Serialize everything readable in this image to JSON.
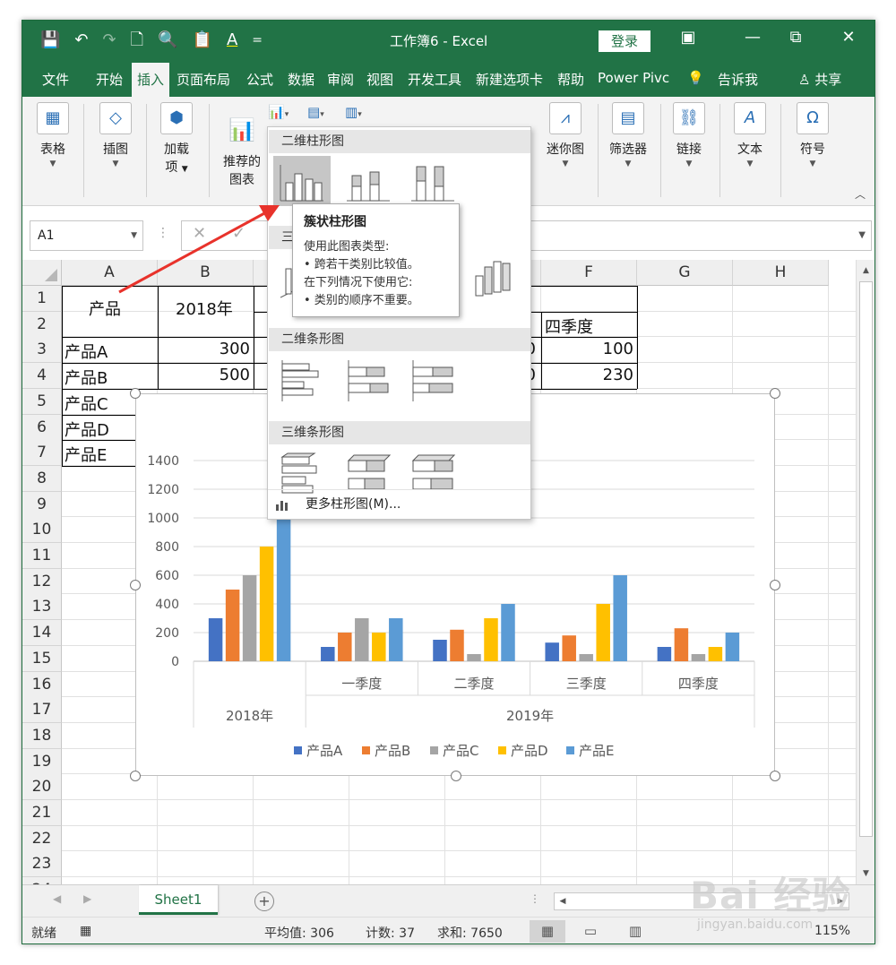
{
  "window": {
    "title": "工作簿6  -  Excel",
    "login_label": "登录",
    "minimize": "—",
    "restore": "⧉",
    "close": "✕",
    "ribbon_display": "▣"
  },
  "qat": {
    "save_icon": "💾",
    "undo_icon": "↶",
    "redo_icon": "↷",
    "new_icon": "🗋",
    "preview_icon": "🔍",
    "paste_icon": "📋",
    "font_color_label": "A",
    "more_icon": "="
  },
  "tabs": [
    {
      "label": "文件"
    },
    {
      "label": "开始"
    },
    {
      "label": "插入",
      "active": true
    },
    {
      "label": "页面布局"
    },
    {
      "label": "公式"
    },
    {
      "label": "数据"
    },
    {
      "label": "审阅"
    },
    {
      "label": "视图"
    },
    {
      "label": "开发工具"
    },
    {
      "label": "新建选项卡"
    },
    {
      "label": "帮助"
    },
    {
      "label": "Power Pivc"
    },
    {
      "label": "告诉我"
    },
    {
      "label": "共享"
    }
  ],
  "ribbon": {
    "table": {
      "label": "表格"
    },
    "illustrations": {
      "label": "插图"
    },
    "addins": {
      "label1": "加载",
      "label2": "项"
    },
    "recommended": {
      "label1": "推荐的",
      "label2": "图表"
    },
    "sparklines": {
      "label": "迷你图"
    },
    "filters": {
      "label": "筛选器"
    },
    "links": {
      "label": "链接"
    },
    "text": {
      "label": "文本"
    },
    "symbols": {
      "label": "符号"
    }
  },
  "formula_bar": {
    "name_box": "A1",
    "dots": "⋮",
    "cancel_icon": "✕",
    "enter_icon": "✓",
    "value": ""
  },
  "grid": {
    "columns": [
      "A",
      "B",
      "C",
      "D",
      "E",
      "F",
      "G",
      "H"
    ],
    "rows": [
      "1",
      "2",
      "3",
      "4",
      "5",
      "6",
      "7",
      "8",
      "9",
      "10",
      "11",
      "12",
      "13",
      "14",
      "15",
      "16",
      "17",
      "18",
      "19",
      "20",
      "21",
      "22",
      "23",
      "24"
    ],
    "cells": {
      "A1": "产品",
      "B1": "2018年",
      "F2": "四季度",
      "A3": "产品A",
      "B3": "300",
      "E3_partial": "0",
      "F3": "100",
      "A4": "产品B",
      "B4": "500",
      "E4_partial": "0",
      "F4": "230",
      "A5": "产品C",
      "A6": "产品D",
      "A7": "产品E"
    }
  },
  "gallery": {
    "section_2d_column": "二维柱形图",
    "section_3d_column_partial": "三",
    "section_2d_bar_partial": "二维条形图",
    "section_3d_bar": "三维条形图",
    "more_label": "更多柱形图(M)..."
  },
  "tooltip": {
    "title": "簇状柱形图",
    "line1": "使用此图表类型:",
    "line2": "• 跨若干类别比较值。",
    "line3": "在下列情况下使用它:",
    "line4": "• 类别的顺序不重要。"
  },
  "sheets": {
    "active": "Sheet1",
    "add_icon": "+"
  },
  "status": {
    "ready": "就绪",
    "average": "平均值: 306",
    "count": "计数: 37",
    "sum": "求和: 7650",
    "zoom": "115%"
  },
  "watermark": {
    "logo": "Bai 经验",
    "site": "jingyan.baidu.com"
  },
  "colors": {
    "excel_green": "#217346",
    "series": [
      "#4472C4",
      "#ED7D31",
      "#A5A5A5",
      "#FFC000",
      "#5B9BD5"
    ]
  },
  "chart_data": {
    "type": "bar",
    "categories": [
      "2018年",
      "一季度",
      "二季度",
      "三季度",
      "四季度"
    ],
    "group_labels": [
      {
        "label": "2018年",
        "span": [
          0,
          0
        ]
      },
      {
        "label": "2019年",
        "span": [
          1,
          4
        ]
      }
    ],
    "series": [
      {
        "name": "产品A",
        "values": [
          300,
          100,
          150,
          130,
          100
        ]
      },
      {
        "name": "产品B",
        "values": [
          500,
          200,
          220,
          180,
          230
        ]
      },
      {
        "name": "产品C",
        "values": [
          600,
          300,
          50,
          50,
          50
        ]
      },
      {
        "name": "产品D",
        "values": [
          800,
          200,
          300,
          400,
          100
        ]
      },
      {
        "name": "产品E",
        "values": [
          1000,
          300,
          400,
          600,
          200
        ]
      }
    ],
    "yticks": [
      "0",
      "200",
      "400",
      "600",
      "800",
      "1000",
      "1200",
      "1400"
    ],
    "ylim": [
      0,
      1400
    ],
    "grid": true,
    "legend": "bottom"
  }
}
